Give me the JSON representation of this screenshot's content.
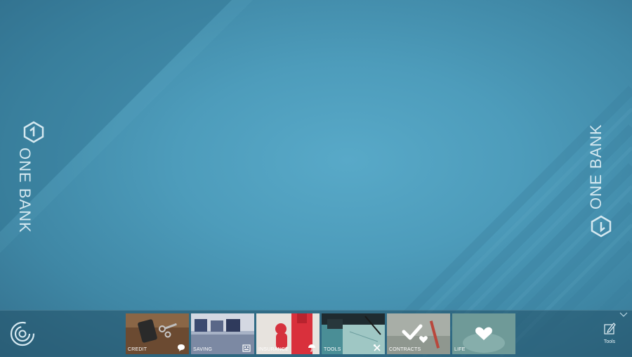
{
  "brand": {
    "left_text": "ONE BANK",
    "right_text": "ONE BANK"
  },
  "taskbar": {
    "home_icon": "swirl-logo-icon",
    "tiles": [
      {
        "label": "CREDIT",
        "icon": "chat-bubble-icon",
        "color": "#7a5a3c"
      },
      {
        "label": "SAVING",
        "icon": "building-icon",
        "color": "#8a97ad"
      },
      {
        "label": "INSURANCE",
        "icon": "umbrella-icon",
        "color": "#d9434f"
      },
      {
        "label": "TOOLS",
        "icon": "tools-icon",
        "color": "#3c7d87"
      },
      {
        "label": "CONTRACTS",
        "icon": "checkmark-heart-icon",
        "color": "#9aa39d"
      },
      {
        "label": "LIFE",
        "icon": "heart-icon",
        "color": "#7fa7a3"
      }
    ],
    "tools_label": "Tools",
    "chevron_icon": "chevron-down-icon"
  },
  "colors": {
    "background": "#4d9cbb",
    "taskbar": "#2f6580"
  }
}
